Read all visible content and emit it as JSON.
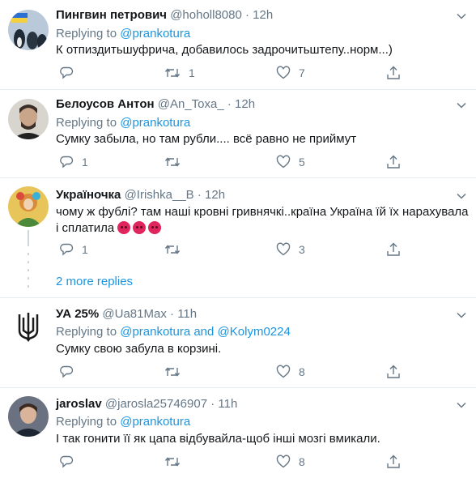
{
  "tweets": [
    {
      "name": "Пингвин петрович",
      "handle": "@hoholl8080",
      "time": "12h",
      "replying_prefix": "Replying to ",
      "replying_to": "@prankotura",
      "text": "К отпиздитьшуфрича, добавилось задрочитьштепу..норм...)",
      "replies": "",
      "retweets": "1",
      "likes": "7"
    },
    {
      "name": "Белоусов Антон",
      "handle": "@An_Toxa_",
      "time": "12h",
      "replying_prefix": "Replying to ",
      "replying_to": "@prankotura",
      "text": "Сумку забыла, но там рубли.... всё равно не приймут",
      "replies": "1",
      "retweets": "",
      "likes": "5"
    },
    {
      "name": "Україночка",
      "handle": "@Irishka__B",
      "time": "12h",
      "text": "чому ж фублі? там наші кровні гривнячкі..країна Україна їй їх нарахувала і сплатила",
      "replies": "1",
      "retweets": "",
      "likes": "3"
    },
    {
      "name": "УА 25%",
      "handle": "@Ua81Max",
      "time": "11h",
      "replying_prefix": "Replying to ",
      "replying_to": "@prankotura",
      "replying_and": " and ",
      "replying_to2": "@Kolym0224",
      "text": "Сумку свою забула в корзині.",
      "replies": "",
      "retweets": "",
      "likes": "8"
    },
    {
      "name": "jaroslav",
      "handle": "@jarosla25746907",
      "time": "11h",
      "replying_prefix": "Replying to ",
      "replying_to": "@prankotura",
      "text": "І так гонити її як цапа відбувайла-щоб інші мозгі вмикали.",
      "replies": "",
      "retweets": "",
      "likes": "8"
    }
  ],
  "more_replies": "2 more replies",
  "separator": " · ",
  "colors": {
    "link": "#1b95e0",
    "muted": "#657786",
    "divider": "#e6ecf0"
  }
}
